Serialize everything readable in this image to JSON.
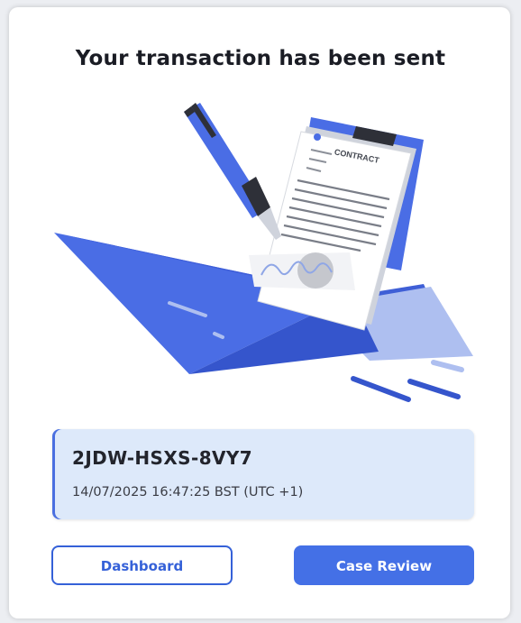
{
  "header": {
    "title": "Your transaction has been sent"
  },
  "illustration": {
    "contract_label": "CONTRACT",
    "accent": "#4a6de5"
  },
  "transaction": {
    "id": "2JDW-HSXS-8VY7",
    "timestamp": "14/07/2025 16:47:25 BST (UTC +1)"
  },
  "actions": {
    "dashboard_label": "Dashboard",
    "case_review_label": "Case Review"
  },
  "colors": {
    "primary": "#4470e6",
    "panel": "#dde9fa",
    "text": "#1a1c24"
  }
}
